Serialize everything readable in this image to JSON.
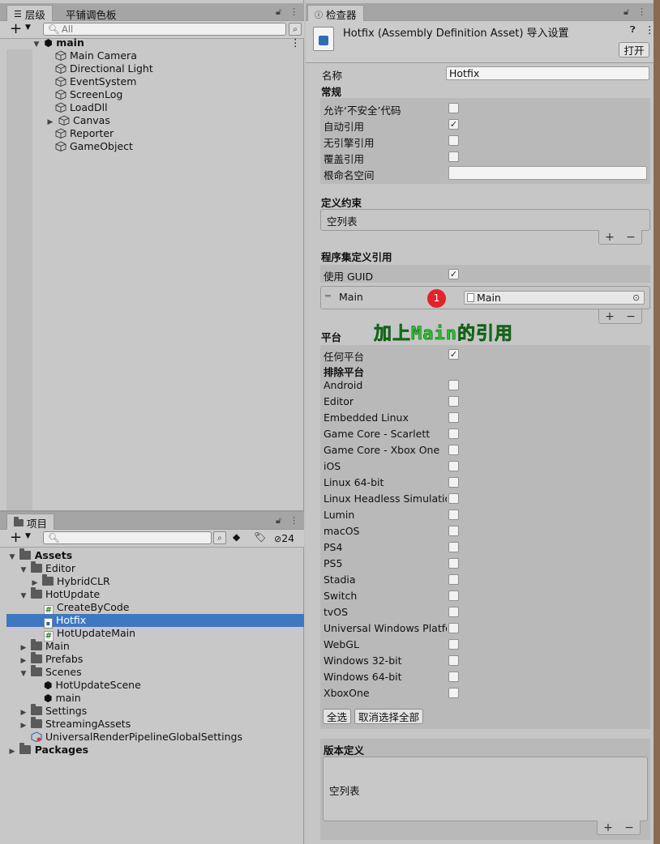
{
  "hierarchy": {
    "tabs": [
      "层级",
      "平铺调色板"
    ],
    "search_placeholder": "All",
    "scene": "main",
    "items": [
      "Main Camera",
      "Directional Light",
      "EventSystem",
      "ScreenLog",
      "LoadDll",
      "Canvas",
      "Reporter",
      "GameObject"
    ]
  },
  "project": {
    "tab": "项目",
    "hidden_count": "24",
    "tree": {
      "assets": "Assets",
      "editor": "Editor",
      "hybridclr": "HybridCLR",
      "hotupdate": "HotUpdate",
      "createbycode": "CreateByCode",
      "hotfix": "Hotfix",
      "hotupdatemain": "HotUpdateMain",
      "main": "Main",
      "prefabs": "Prefabs",
      "scenes": "Scenes",
      "hotupdatescene": "HotUpdateScene",
      "main_scene": "main",
      "settings": "Settings",
      "streamingassets": "StreamingAssets",
      "urp_settings": "UniversalRenderPipelineGlobalSettings",
      "packages": "Packages"
    }
  },
  "inspector": {
    "tab": "检查器",
    "title": "Hotfix (Assembly Definition Asset) 导入设置",
    "open_button": "打开",
    "name_label": "名称",
    "name_value": "Hotfix",
    "general": {
      "title": "常规",
      "allow_unsafe": "允许‘不安全’代码",
      "auto_referenced": "自动引用",
      "no_engine_references": "无引擎引用",
      "override_references": "覆盖引用",
      "root_namespace": "根命名空间"
    },
    "define_constraints": {
      "title": "定义约束",
      "empty": "空列表"
    },
    "assembly_refs": {
      "title": "程序集定义引用",
      "use_guid": "使用 GUID",
      "ref_name": "Main",
      "ref_value": "Main",
      "badge": "1",
      "annotation": "加上Main的引用"
    },
    "platforms": {
      "title": "平台",
      "any_platform": "任何平台",
      "exclude_title": "排除平台",
      "list": [
        "Android",
        "Editor",
        "Embedded Linux",
        "Game Core - Scarlett",
        "Game Core - Xbox One",
        "iOS",
        "Linux 64-bit",
        "Linux Headless Simulation",
        "Lumin",
        "macOS",
        "PS4",
        "PS5",
        "Stadia",
        "Switch",
        "tvOS",
        "Universal Windows Platfor",
        "WebGL",
        "Windows 32-bit",
        "Windows 64-bit",
        "XboxOne"
      ],
      "select_all": "全选",
      "deselect_all": "取消选择全部"
    },
    "version_defines": {
      "title": "版本定义",
      "empty": "空列表"
    },
    "plus": "+",
    "minus": "−",
    "check": "✓"
  }
}
